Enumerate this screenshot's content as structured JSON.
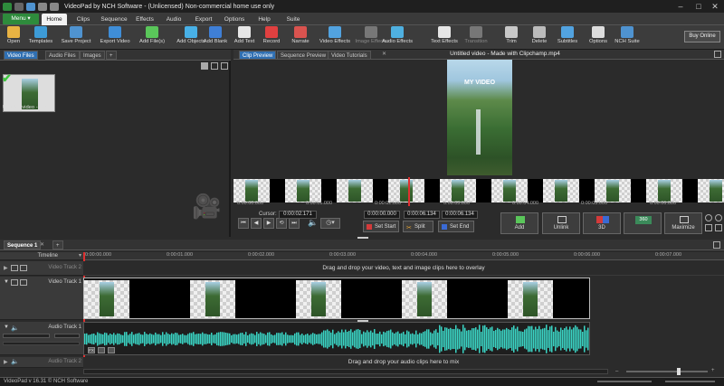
{
  "app": {
    "title": "VideoPad by NCH Software - (Unlicensed) Non-commercial home use only",
    "status": "VideoPad v 16.31 © NCH Software"
  },
  "menu": {
    "menu_label": "Menu ▾",
    "tabs": [
      "Home",
      "Clips",
      "Sequence",
      "Effects",
      "Audio",
      "Export",
      "Options",
      "Help",
      "Suite"
    ]
  },
  "toolbar": {
    "buttons": [
      {
        "label": "Open",
        "color": "#e8b343"
      },
      {
        "label": "Templates",
        "color": "#3d9bd6"
      },
      {
        "label": "Save Project",
        "color": "#4f93d0"
      },
      {
        "label": "Export Video",
        "color": "#3f8ed8"
      },
      {
        "label": "Add File(s)",
        "color": "#5ac65a"
      },
      {
        "label": "Add Objects",
        "color": "#48b0e6"
      },
      {
        "label": "Add Blank",
        "color": "#3f7fd6"
      },
      {
        "label": "Add Text",
        "color": "#e6e6e6"
      },
      {
        "label": "Record",
        "color": "#e04040"
      },
      {
        "label": "Narrate",
        "color": "#d9534f"
      },
      {
        "label": "Video Effects",
        "color": "#52a3e0"
      },
      {
        "label": "Image Effects",
        "color": "#777777"
      },
      {
        "label": "Audio Effects",
        "color": "#4fb0e0"
      },
      {
        "label": "Text Effects",
        "color": "#e6e6e6"
      },
      {
        "label": "Transition",
        "color": "#777777"
      },
      {
        "label": "Trim",
        "color": "#c8c8c8"
      },
      {
        "label": "Delete",
        "color": "#bbbbbb"
      },
      {
        "label": "Subtitles",
        "color": "#52a3e0"
      },
      {
        "label": "Options",
        "color": "#dddddd"
      },
      {
        "label": "NCH Suite",
        "color": "#4f93d0"
      }
    ],
    "buy_label": "Buy Online"
  },
  "media": {
    "tabs": [
      "Video Files",
      "Audio Files",
      "Images",
      "+"
    ],
    "clip_name": "Untitled video - Mad..."
  },
  "preview": {
    "tabs": [
      "Clip Preview",
      "Sequence Preview",
      "Video Tutorials"
    ],
    "file_title": "Untitled video - Made with Clipchamp.mp4",
    "overlay_text": "MY VIDEO",
    "ruler_ticks": [
      "0:00:00.000",
      "0:00:01.000",
      "0:00:02.000",
      "0:00:03.000",
      "0:00:04.000",
      "0:00:05.000",
      "0:00:06.000"
    ],
    "cursor_label": "Cursor:",
    "cursor_value": "0:00:02.171",
    "start_time": "0:00:00.000",
    "end_time": "0:00:06.134",
    "duration_a": "0:00:06.134",
    "duration_b": "0:00:06.134",
    "set_start": "Set Start",
    "split": "Split",
    "set_end": "Set End",
    "add": "Add",
    "unlink": "Unlink",
    "threed": "3D",
    "three60": "360",
    "maximize": "Maximize"
  },
  "timeline": {
    "sequence_tab": "Sequence 1",
    "header": "Timeline",
    "ruler_ticks": [
      "0:00:00.000",
      "0:00:01.000",
      "0:00:02.000",
      "0:00:03.000",
      "0:00:04.000",
      "0:00:05.000",
      "0:00:06.000",
      "0:00:07.000"
    ],
    "video_track_2": "Video Track 2",
    "video_track_1": "Video Track 1",
    "audio_track_1": "Audio Track 1",
    "audio_track_2": "Audio Track 2",
    "overlay_hint": "Drag and drop your video, text and image clips here to overlay",
    "audio_hint": "Drag and drop your audio clips here to mix"
  }
}
